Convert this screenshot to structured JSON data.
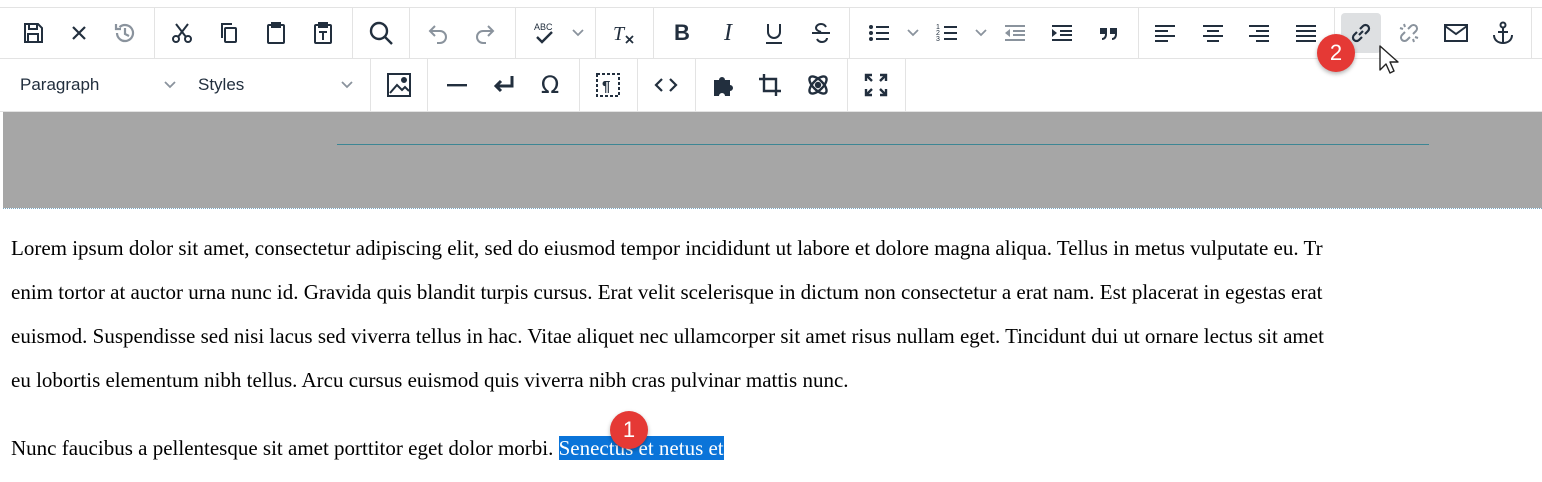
{
  "toolbar": {
    "row1": [
      {
        "name": "save-button",
        "icon": "save-icon"
      },
      {
        "name": "cancel-button",
        "icon": "close-icon"
      },
      {
        "name": "restore-draft-button",
        "icon": "history-icon"
      },
      {
        "name": "cut-button",
        "icon": "scissors-icon"
      },
      {
        "name": "copy-button",
        "icon": "copy-icon"
      },
      {
        "name": "paste-button",
        "icon": "clipboard-icon"
      },
      {
        "name": "paste-text-button",
        "icon": "paste-text-icon"
      },
      {
        "name": "find-replace-button",
        "icon": "search-icon"
      },
      {
        "name": "undo-button",
        "icon": "undo-icon"
      },
      {
        "name": "redo-button",
        "icon": "redo-icon"
      },
      {
        "name": "spellcheck-button",
        "icon": "spellcheck-icon"
      },
      {
        "name": "clear-formatting-button",
        "icon": "remove-format-icon"
      },
      {
        "name": "bold-button",
        "icon": "bold-icon"
      },
      {
        "name": "italic-button",
        "icon": "italic-icon"
      },
      {
        "name": "underline-button",
        "icon": "underline-icon"
      },
      {
        "name": "strikethrough-button",
        "icon": "strikethrough-icon"
      },
      {
        "name": "bullet-list-button",
        "icon": "bullet-list-icon"
      },
      {
        "name": "numbered-list-button",
        "icon": "numbered-list-icon"
      },
      {
        "name": "outdent-button",
        "icon": "outdent-icon"
      },
      {
        "name": "indent-button",
        "icon": "indent-icon"
      },
      {
        "name": "blockquote-button",
        "icon": "quote-icon"
      },
      {
        "name": "align-left-button",
        "icon": "align-left-icon"
      },
      {
        "name": "align-center-button",
        "icon": "align-center-icon"
      },
      {
        "name": "align-right-button",
        "icon": "align-right-icon"
      },
      {
        "name": "align-justify-button",
        "icon": "align-justify-icon"
      },
      {
        "name": "insert-link-button",
        "icon": "link-icon"
      },
      {
        "name": "unlink-button",
        "icon": "unlink-icon"
      },
      {
        "name": "email-link-button",
        "icon": "envelope-icon"
      },
      {
        "name": "anchor-button",
        "icon": "anchor-icon"
      }
    ],
    "row2": [
      {
        "name": "image-button",
        "icon": "image-icon"
      },
      {
        "name": "horizontal-rule-button",
        "icon": "horizontal-rule-icon"
      },
      {
        "name": "line-break-button",
        "icon": "line-break-icon"
      },
      {
        "name": "special-char-button",
        "icon": "omega-icon"
      },
      {
        "name": "show-blocks-button",
        "icon": "pilcrow-icon"
      },
      {
        "name": "source-code-button",
        "icon": "code-icon"
      },
      {
        "name": "plugin-button",
        "icon": "puzzle-icon"
      },
      {
        "name": "crop-button",
        "icon": "crop-icon"
      },
      {
        "name": "custom-element-button",
        "icon": "atom-icon"
      },
      {
        "name": "fullscreen-button",
        "icon": "fullscreen-icon"
      }
    ],
    "block_format": {
      "value": "Paragraph"
    },
    "styles": {
      "value": "Styles"
    },
    "spellcheck_label": "ABC"
  },
  "content": {
    "lines": [
      "Lorem ipsum dolor sit amet, consectetur adipiscing elit, sed do eiusmod tempor incididunt ut labore et dolore magna aliqua. Tellus in metus vulputate eu. Tr",
      "enim tortor at auctor urna nunc id. Gravida quis blandit turpis cursus. Erat velit scelerisque in dictum non consectetur a erat nam. Est placerat in egestas erat",
      "euismod. Suspendisse sed nisi lacus sed viverra tellus in hac. Vitae aliquet nec ullamcorper sit amet risus nullam eget. Tincidunt dui ut ornare lectus sit amet",
      "eu lobortis elementum nibh tellus. Arcu cursus euismod quis viverra nibh cras pulvinar mattis nunc."
    ],
    "para2_plain": "Nunc faucibus a pellentesque sit amet porttitor eget dolor morbi. ",
    "para2_selected": "Senectus et netus et"
  },
  "markers": {
    "step1": "1",
    "step2": "2"
  },
  "colors": {
    "selection": "#0a74d9",
    "marker": "#e53935",
    "header_band": "#a6a6a6",
    "active_button": "#dee0e2"
  }
}
